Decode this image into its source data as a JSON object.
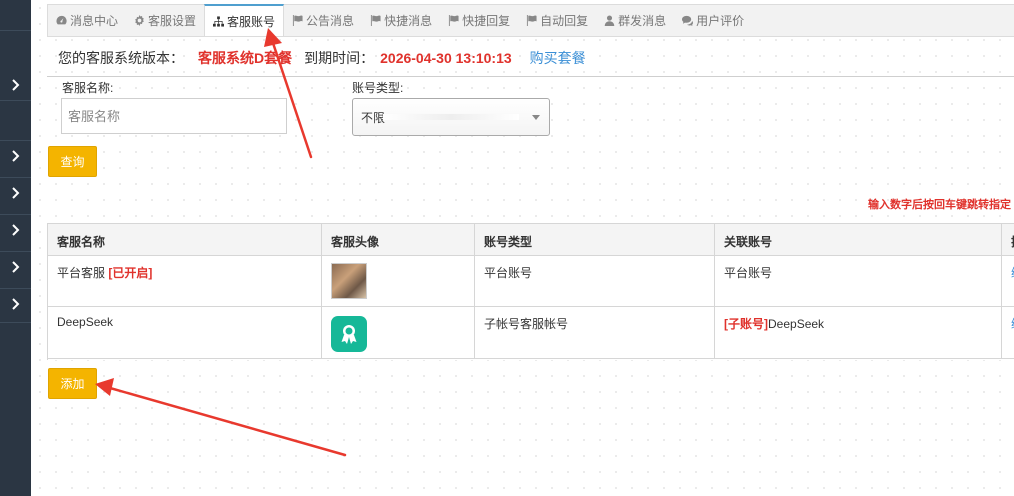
{
  "tabs": [
    {
      "label": "消息中心",
      "icon": "dashboard-icon"
    },
    {
      "label": "客服设置",
      "icon": "gear-icon"
    },
    {
      "label": "客服账号",
      "icon": "sitemap-icon",
      "active": true
    },
    {
      "label": "公告消息",
      "icon": "flag-icon"
    },
    {
      "label": "快捷消息",
      "icon": "flag-icon"
    },
    {
      "label": "快捷回复",
      "icon": "flag-icon"
    },
    {
      "label": "自动回复",
      "icon": "flag-icon"
    },
    {
      "label": "群发消息",
      "icon": "user-icon"
    },
    {
      "label": "用户评价",
      "icon": "comments-icon"
    }
  ],
  "version": {
    "label": "您的客服系统版本：",
    "plan": "客服系统D套餐",
    "expire_label": "到期时间：",
    "expire_value": "2026-04-30 13:10:13",
    "buy_link": "购买套餐"
  },
  "filters": {
    "name_label": "客服名称:",
    "name_placeholder": "客服名称",
    "type_label": "账号类型:",
    "type_value": "不限",
    "query_button": "查询"
  },
  "hint": "输入数字后按回车键跳转指定",
  "table": {
    "columns": [
      "客服名称",
      "客服头像",
      "账号类型",
      "关联账号",
      "操"
    ],
    "rows": [
      {
        "name": "平台客服",
        "name_tag": "[已开启]",
        "type": "平台账号",
        "link_tag": "",
        "linked": "平台账号",
        "action": "编"
      },
      {
        "name": "DeepSeek",
        "name_tag": "",
        "type": "子帐号客服帐号",
        "link_tag": "[子账号]",
        "linked": "DeepSeek",
        "action": "编"
      }
    ]
  },
  "add_button": "添加",
  "colors": {
    "accent": "#f4b400",
    "danger": "#e0322c",
    "link": "#3b8fd6",
    "sidebar": "#2b3643"
  }
}
